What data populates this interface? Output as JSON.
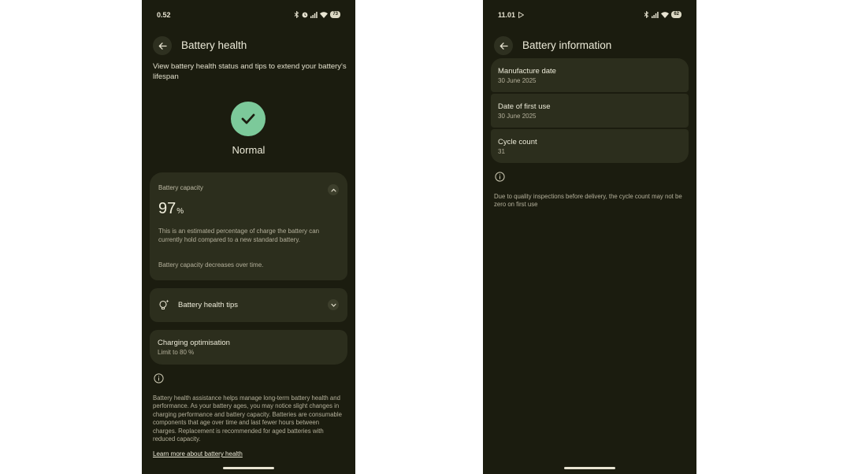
{
  "left_screen": {
    "status_bar": {
      "time": "0.52",
      "battery": "73"
    },
    "title": "Battery health",
    "subtitle": "View battery health status and tips to extend your battery's lifespan",
    "status": "Normal",
    "capacity": {
      "title": "Battery capacity",
      "value": "97",
      "unit": "%",
      "description": "This is an estimated percentage of charge the battery can currently hold compared to a new standard battery.",
      "note": "Battery capacity decreases over time."
    },
    "tips": {
      "label": "Battery health tips"
    },
    "charging": {
      "label": "Charging optimisation",
      "sub": "Limit to 80 %"
    },
    "footer": "Battery health assistance helps manage long-term battery health and performance. As your battery ages, you may notice slight changes in charging performance and battery capacity. Batteries are consumable components that age over time and last fewer hours between charges. Replacement is recommended for aged batteries with reduced capacity.",
    "link": "Learn more about battery health"
  },
  "right_screen": {
    "status_bar": {
      "time": "11.01",
      "battery": "62"
    },
    "title": "Battery information",
    "items": [
      {
        "title": "Manufacture date",
        "value": "30 June 2025"
      },
      {
        "title": "Date of first use",
        "value": "30 June 2025"
      },
      {
        "title": "Cycle count",
        "value": "31"
      }
    ],
    "note": "Due to quality inspections before delivery, the cycle count may not be zero on first use"
  },
  "colors": {
    "background": "#1b1c0f",
    "card": "#2c2e1d",
    "accent_green": "#7cc99a",
    "text": "#ecead8",
    "muted_text": "#b4b09b"
  },
  "icons": {
    "back": "arrow-left-icon",
    "status_ok": "check-icon",
    "expand": "chevron-up-icon",
    "collapse": "chevron-down-icon",
    "tips": "lightbulb-sparkle-icon",
    "info": "info-icon"
  }
}
